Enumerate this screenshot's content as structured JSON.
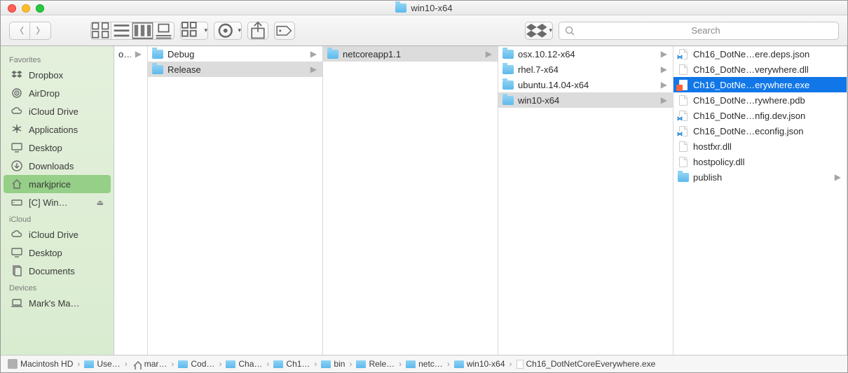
{
  "window_title": "win10-x64",
  "search_placeholder": "Search",
  "sidebar": {
    "sections": [
      {
        "header": "Favorites",
        "items": [
          {
            "icon": "dropbox",
            "label": "Dropbox"
          },
          {
            "icon": "airdrop",
            "label": "AirDrop"
          },
          {
            "icon": "icloud",
            "label": "iCloud Drive"
          },
          {
            "icon": "apps",
            "label": "Applications"
          },
          {
            "icon": "desktop",
            "label": "Desktop"
          },
          {
            "icon": "downloads",
            "label": "Downloads"
          },
          {
            "icon": "home",
            "label": "markjprice",
            "selected": true
          },
          {
            "icon": "drive",
            "label": "[C] Win…",
            "eject": true
          }
        ]
      },
      {
        "header": "iCloud",
        "items": [
          {
            "icon": "icloud",
            "label": "iCloud Drive"
          },
          {
            "icon": "desktop",
            "label": "Desktop"
          },
          {
            "icon": "documents",
            "label": "Documents"
          }
        ]
      },
      {
        "header": "Devices",
        "items": [
          {
            "icon": "laptop",
            "label": "Mark's Ma…"
          }
        ]
      }
    ]
  },
  "columns": {
    "col0": [
      {
        "label": "oroj",
        "arrow": true
      }
    ],
    "col1": [
      {
        "icon": "folder",
        "label": "Debug",
        "arrow": true
      },
      {
        "icon": "folder",
        "label": "Release",
        "arrow": true,
        "sel": "gray"
      }
    ],
    "col2": [
      {
        "icon": "folder",
        "label": "netcoreapp1.1",
        "arrow": true,
        "sel": "gray"
      }
    ],
    "col3": [
      {
        "icon": "folder",
        "label": "osx.10.12-x64",
        "arrow": true
      },
      {
        "icon": "folder",
        "label": "rhel.7-x64",
        "arrow": true
      },
      {
        "icon": "folder",
        "label": "ubuntu.14.04-x64",
        "arrow": true
      },
      {
        "icon": "folder",
        "label": "win10-x64",
        "arrow": true,
        "sel": "gray"
      }
    ],
    "col4": [
      {
        "icon": "vs",
        "label": "Ch16_DotNe…ere.deps.json"
      },
      {
        "icon": "doc",
        "label": "Ch16_DotNe…verywhere.dll"
      },
      {
        "icon": "exe",
        "label": "Ch16_DotNe…erywhere.exe",
        "sel": "blue"
      },
      {
        "icon": "doc",
        "label": "Ch16_DotNe…rywhere.pdb"
      },
      {
        "icon": "vs",
        "label": "Ch16_DotNe…nfig.dev.json"
      },
      {
        "icon": "vs",
        "label": "Ch16_DotNe…econfig.json"
      },
      {
        "icon": "doc",
        "label": "hostfxr.dll"
      },
      {
        "icon": "doc",
        "label": "hostpolicy.dll"
      },
      {
        "icon": "folder",
        "label": "publish",
        "arrow": true
      }
    ]
  },
  "pathbar": [
    {
      "icon": "hd",
      "label": "Macintosh HD"
    },
    {
      "icon": "folder",
      "label": "Use…"
    },
    {
      "icon": "home",
      "label": "mar…"
    },
    {
      "icon": "folder",
      "label": "Cod…"
    },
    {
      "icon": "folder",
      "label": "Cha…"
    },
    {
      "icon": "folder",
      "label": "Ch1…"
    },
    {
      "icon": "folder",
      "label": "bin"
    },
    {
      "icon": "folder",
      "label": "Rele…"
    },
    {
      "icon": "folder",
      "label": "netc…"
    },
    {
      "icon": "folder",
      "label": "win10-x64"
    },
    {
      "icon": "doc",
      "label": "Ch16_DotNetCoreEverywhere.exe"
    }
  ]
}
